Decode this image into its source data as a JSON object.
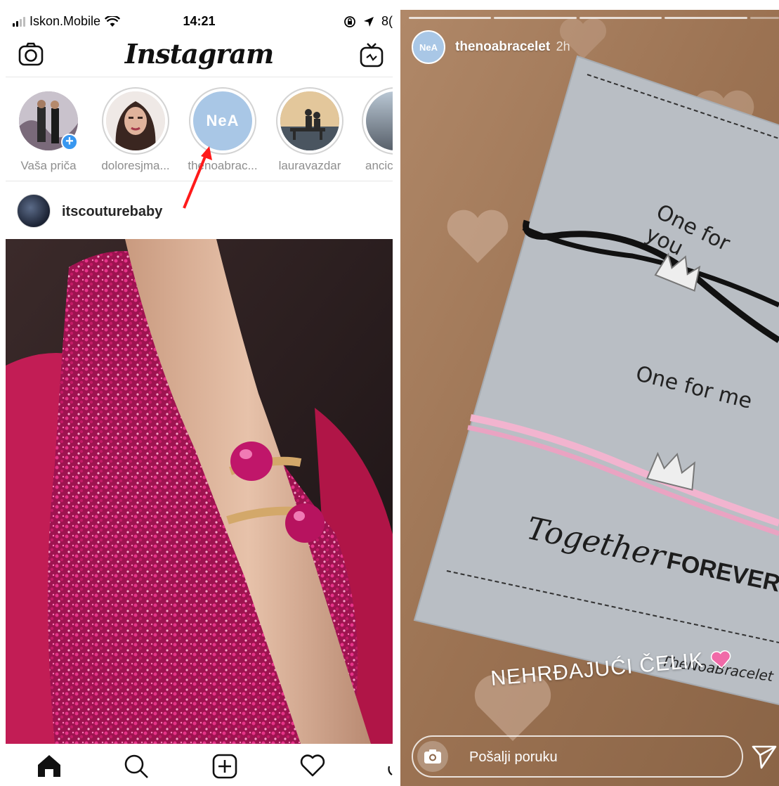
{
  "status_bar": {
    "carrier": "Iskon.Mobile",
    "time": "14:21",
    "battery_partial": "8("
  },
  "header": {
    "logo": "Instagram"
  },
  "stories": [
    {
      "label": "Vaša priča",
      "own": true
    },
    {
      "label": "doloresjma..."
    },
    {
      "label": "thenoabrac..."
    },
    {
      "label": "lauravazdar"
    },
    {
      "label": "ancic"
    }
  ],
  "story_avatar_text": "NeA",
  "post": {
    "username": "itscouturebaby"
  },
  "story_view": {
    "username": "thenoabracelet",
    "time_ago": "2h",
    "avatar_text": "NeA",
    "card_line1": "One for you",
    "card_line2": "One for me",
    "card_line3_script": "Together",
    "card_line3_bold": "FOREVER",
    "card_brand": "TheNoaBracelet",
    "sticker_text": "NEHRĐAJUĆI ČELIK",
    "reply_placeholder": "Pošalji poruku"
  },
  "colors": {
    "accent_blue": "#3897f0",
    "annotation_red": "#ff1a1a",
    "story_bg": "#a17758",
    "card": "#b7bcc2"
  },
  "icons": [
    "camera-icon",
    "igtv-icon",
    "home-icon",
    "search-icon",
    "add-post-icon",
    "heart-icon",
    "send-icon",
    "wifi-icon",
    "location-arrow-icon"
  ]
}
